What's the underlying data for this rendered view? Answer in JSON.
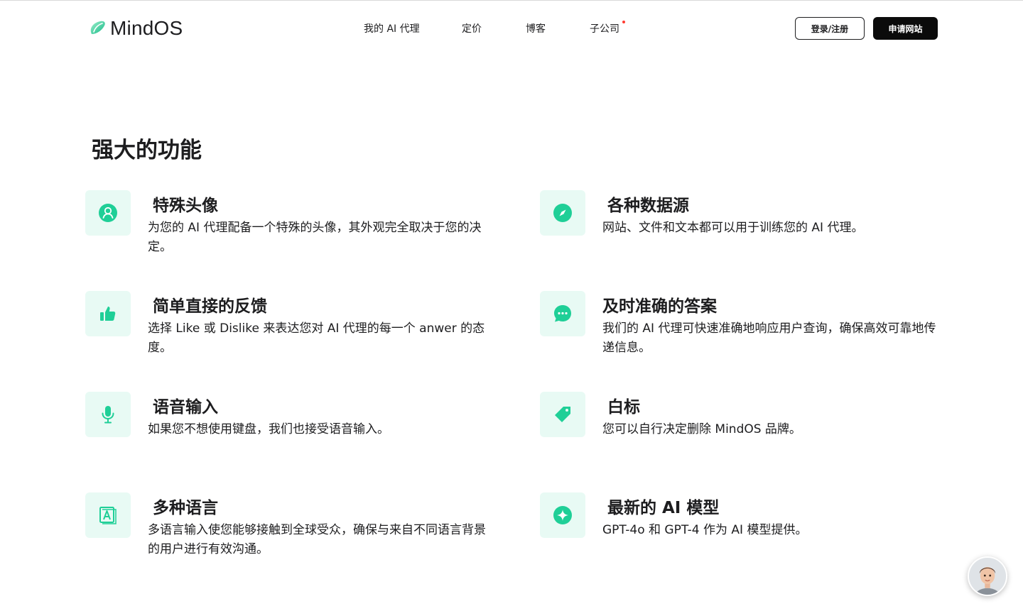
{
  "header": {
    "logo_text": "MindOS",
    "nav": [
      {
        "label": "我的 AI 代理"
      },
      {
        "label": "定价"
      },
      {
        "label": "博客"
      },
      {
        "label": "子公司"
      }
    ],
    "login_label": "登录/注册",
    "apply_label": "申请网站"
  },
  "features_section": {
    "title": "强大的功能",
    "items": [
      {
        "icon": "user-avatar-icon",
        "title": "特殊头像",
        "desc": "为您的 AI 代理配备一个特殊的头像，其外观完全取决于您的决定。"
      },
      {
        "icon": "compass-icon",
        "title": "各种数据源",
        "desc": "网站、文件和文本都可以用于训练您的 AI 代理。"
      },
      {
        "icon": "thumbs-up-icon",
        "title": "简单直接的反馈",
        "desc": "选择 Like 或 Dislike 来表达您对 AI 代理的每一个 anwer 的态度。"
      },
      {
        "icon": "chat-bubble-icon",
        "title": "及时准确的答案",
        "desc": "我们的 AI 代理可快速准确地响应用户查询，确保高效可靠地传递信息。"
      },
      {
        "icon": "microphone-icon",
        "title": "语音输入",
        "desc": "如果您不想使用键盘，我们也接受语音输入。"
      },
      {
        "icon": "price-tag-icon",
        "title": "白标",
        "desc": "您可以自行决定删除 MindOS 品牌。"
      },
      {
        "icon": "translate-icon",
        "title": "多种语言",
        "desc": "多语言输入使您能够接触到全球受众，确保与来自不同语言背景的用户进行有效沟通。"
      },
      {
        "icon": "sparkle-icon",
        "title": "最新的 AI 模型",
        "desc": "GPT-4o 和 GPT-4 作为 AI 模型提供。"
      }
    ]
  },
  "colors": {
    "accent": "#1fcf97",
    "icon_bg": "#e8faf4",
    "text": "#1d1d1f",
    "notification_dot": "#ff3b30"
  }
}
